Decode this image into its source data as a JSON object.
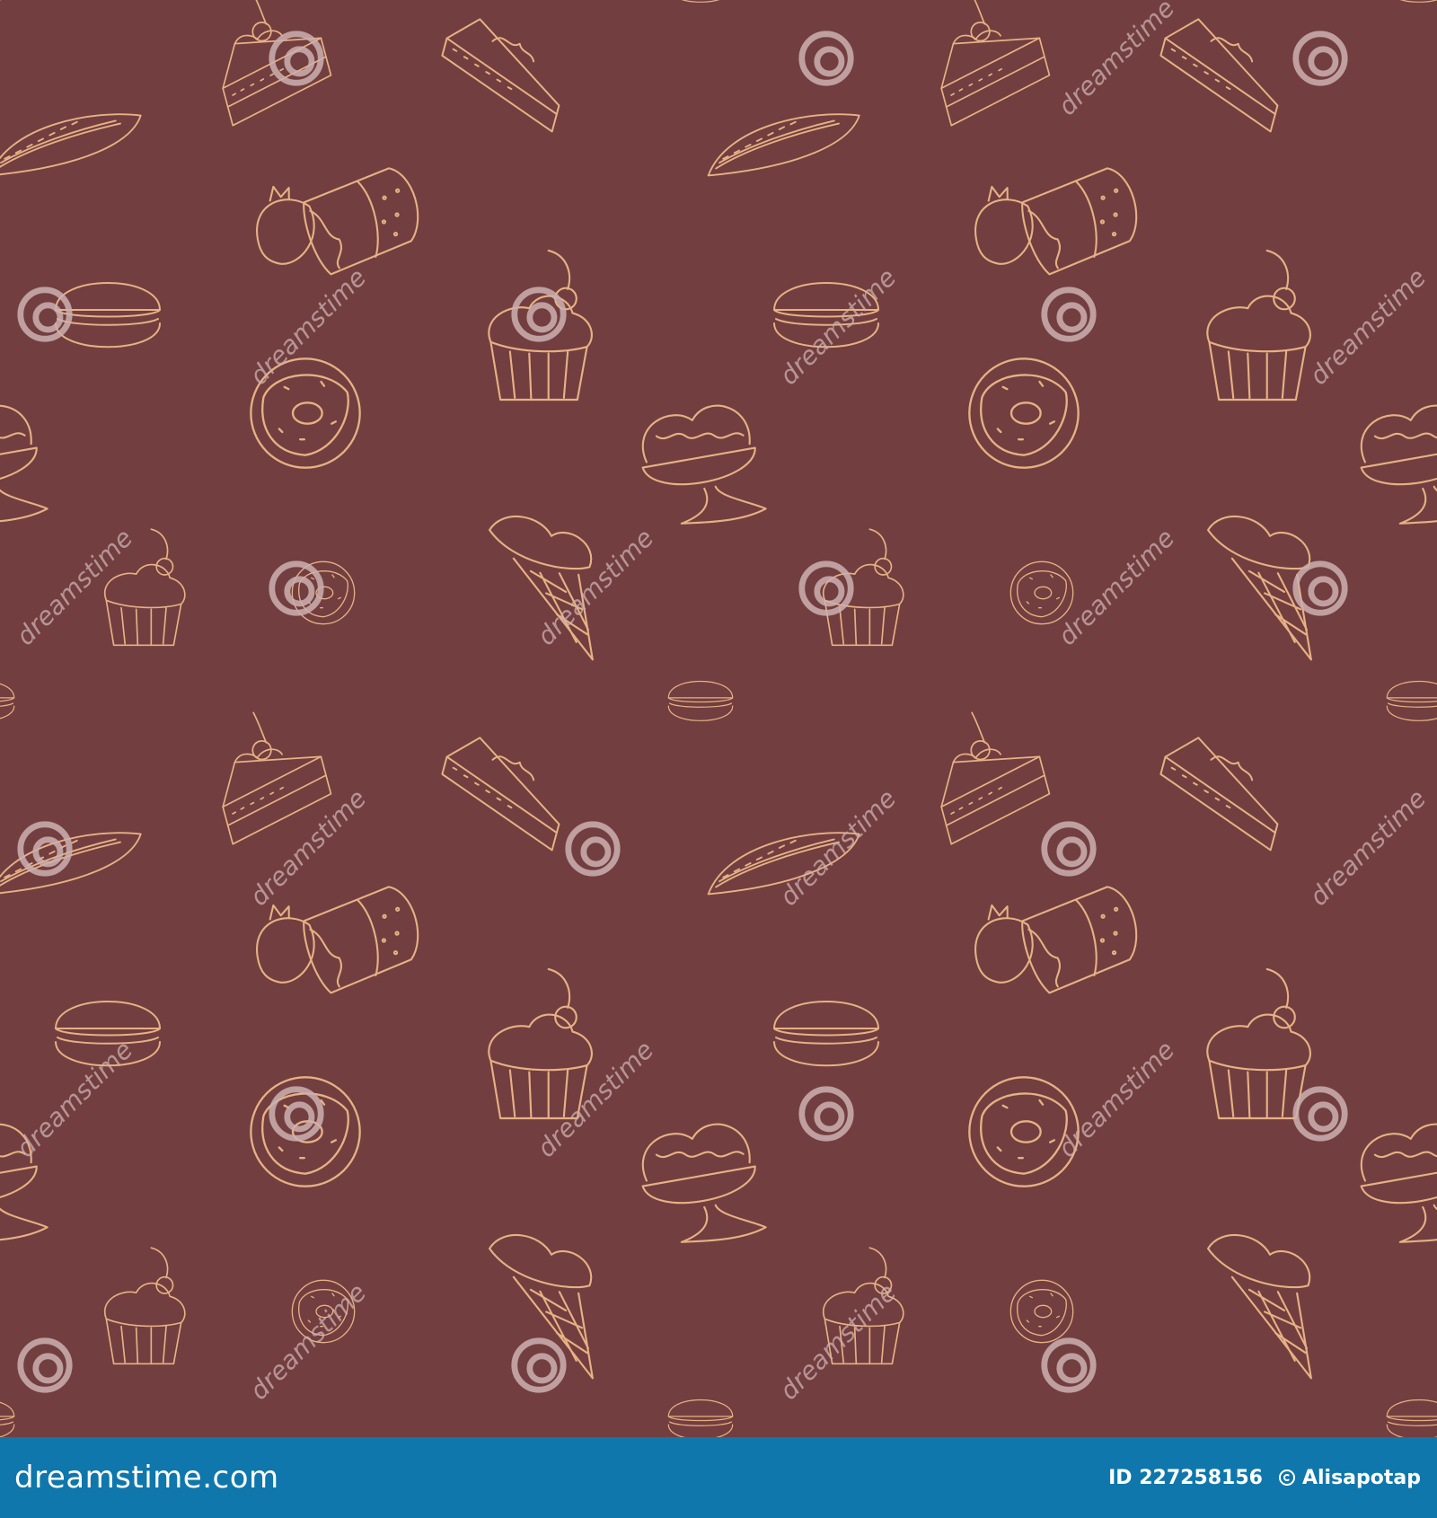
{
  "colors": {
    "background": "#723e3f",
    "line_art": "#e6b184",
    "watermark": "#cdb1b0",
    "footer": "#0f77ab"
  },
  "illustration": {
    "kind": "seamless doodle pattern",
    "motifs": [
      "cake-slice",
      "cheesecake-slice",
      "roll-cake",
      "strawberry-mousse",
      "macaron",
      "cupcake",
      "donut",
      "ice-cream-sundae",
      "ice-cream-cone"
    ]
  },
  "watermark": {
    "text": "dreamstime",
    "icon": "spiral-logo-icon"
  },
  "footer": {
    "brand": "dreamstime.com",
    "id_label": "ID 227258156",
    "author": "Alisapotap",
    "author_icon": "copyright-circle-icon"
  }
}
